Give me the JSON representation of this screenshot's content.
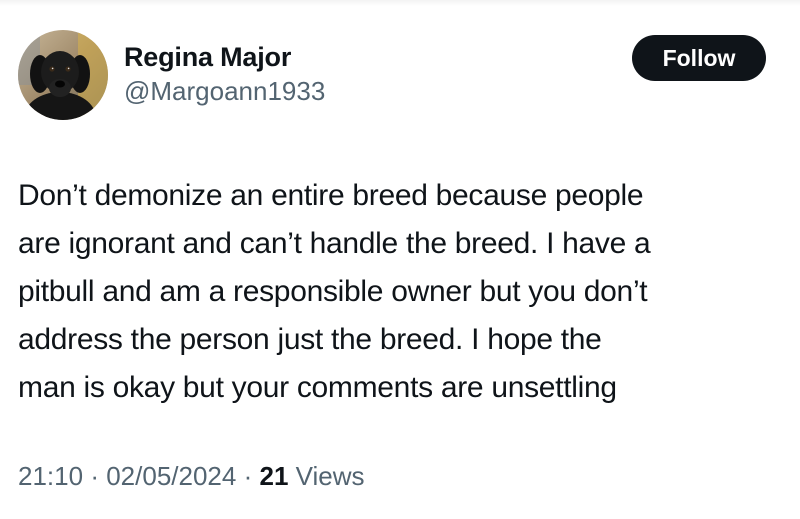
{
  "user": {
    "display_name": "Regina Major",
    "handle": "@Margoann1933",
    "avatar_icon": "black-puppy-avatar"
  },
  "follow_button": {
    "label": "Follow"
  },
  "tweet": {
    "lines": [
      "Don’t demonize an entire breed because people",
      "are ignorant and can’t handle the breed. I have a",
      "pitbull and am a responsible owner but you don’t",
      "address the person just the breed. I hope the",
      "man is okay but your comments are unsettling"
    ]
  },
  "meta": {
    "time": "21:10",
    "separator": "·",
    "date": "02/05/2024",
    "views_count": "21",
    "views_label": "Views"
  },
  "colors": {
    "text_primary": "#0f1419",
    "text_secondary": "#536471",
    "button_bg": "#0f1419",
    "button_text": "#ffffff"
  }
}
